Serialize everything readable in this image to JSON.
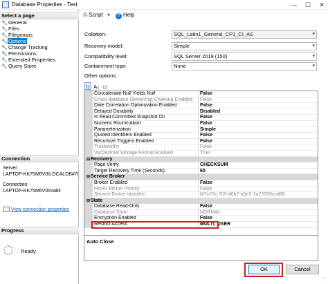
{
  "window": {
    "title": "Database Properties - Test",
    "minimize_glyph": "—",
    "maximize_glyph": "☐",
    "close_glyph": "✕"
  },
  "left": {
    "select_page_header": "Select a page",
    "pages": [
      {
        "label": "General",
        "icon": "wrench-icon",
        "selected": false
      },
      {
        "label": "Files",
        "icon": "wrench-icon",
        "selected": false
      },
      {
        "label": "Filegroups",
        "icon": "wrench-icon",
        "selected": false
      },
      {
        "label": "Options",
        "icon": "wrench-icon",
        "selected": true
      },
      {
        "label": "Change Tracking",
        "icon": "wrench-icon",
        "selected": false
      },
      {
        "label": "Permissions",
        "icon": "wrench-icon",
        "selected": false
      },
      {
        "label": "Extended Properties",
        "icon": "wrench-icon",
        "selected": false
      },
      {
        "label": "Query Store",
        "icon": "wrench-icon",
        "selected": false
      }
    ],
    "connection_header": "Connection",
    "server_label": "Server:",
    "server_value": "LAPTOP-KK75M6V0\\LOCALDB#7(",
    "connection_label": "Connection:",
    "connection_value": "LAPTOP-KK75M6V0\\mail4",
    "view_connection_link": "View connection properties",
    "progress_header": "Progress",
    "progress_status": "Ready"
  },
  "toolbar": {
    "script_label": "Script",
    "help_label": "Help"
  },
  "form": {
    "collation_label": "Collation:",
    "collation_value": "SQL_Latin1_General_CP1_CI_AS",
    "recovery_label": "Recovery model:",
    "recovery_value": "Simple",
    "compat_label": "Compatibility level:",
    "compat_value": "SQL Server 2019 (150)",
    "containment_label": "Containment type:",
    "containment_value": "None",
    "other_options_label": "Other options:"
  },
  "grid": {
    "rows": [
      {
        "type": "prop",
        "name": "Concatenate Null Yields Null",
        "value": "False",
        "readonly": false
      },
      {
        "type": "prop",
        "name": "Cross-database Ownership Chaining Enabled",
        "value": "False",
        "readonly": true
      },
      {
        "type": "prop",
        "name": "Date Correlation Optimization Enabled",
        "value": "False",
        "readonly": false
      },
      {
        "type": "prop",
        "name": "Delayed Durability",
        "value": "Disabled",
        "readonly": false
      },
      {
        "type": "prop",
        "name": "Is Read Committed Snapshot On",
        "value": "False",
        "readonly": false
      },
      {
        "type": "prop",
        "name": "Numeric Round-Abort",
        "value": "False",
        "readonly": false
      },
      {
        "type": "prop",
        "name": "Parameterization",
        "value": "Simple",
        "readonly": false
      },
      {
        "type": "prop",
        "name": "Quoted Identifiers Enabled",
        "value": "False",
        "readonly": false
      },
      {
        "type": "prop",
        "name": "Recursive Triggers Enabled",
        "value": "False",
        "readonly": false
      },
      {
        "type": "prop",
        "name": "Trustworthy",
        "value": "False",
        "readonly": true
      },
      {
        "type": "prop",
        "name": "VarDecimal Storage Format Enabled",
        "value": "True",
        "readonly": true
      },
      {
        "type": "cat",
        "name": "Recovery"
      },
      {
        "type": "prop",
        "name": "Page Verify",
        "value": "CHECKSUM",
        "readonly": false
      },
      {
        "type": "prop",
        "name": "Target Recovery Time (Seconds)",
        "value": "60",
        "readonly": false
      },
      {
        "type": "cat",
        "name": "Service Broker"
      },
      {
        "type": "prop",
        "name": "Broker Enabled",
        "value": "False",
        "readonly": false
      },
      {
        "type": "prop",
        "name": "Honor Broker Priority",
        "value": "False",
        "readonly": true
      },
      {
        "type": "prop",
        "name": "Service Broker Identifier",
        "value": "bf7cf7fc-7f2f-46b7-a3e3-1a72059ccd68",
        "readonly": true
      },
      {
        "type": "cat",
        "name": "State"
      },
      {
        "type": "prop",
        "name": "Database Read-Only",
        "value": "False",
        "readonly": false
      },
      {
        "type": "prop",
        "name": "Database State",
        "value": "NORMAL",
        "readonly": true
      },
      {
        "type": "prop",
        "name": "Encryption Enabled",
        "value": "False",
        "readonly": false
      },
      {
        "type": "prop",
        "name": "Restrict Access",
        "value": "MULTI_USER",
        "readonly": false
      }
    ]
  },
  "description": {
    "title": "Auto Close"
  },
  "buttons": {
    "ok_label": "OK",
    "cancel_label": "Cancel"
  },
  "colors": {
    "selection_blue": "#0078d7",
    "highlight_red": "#cc1f1f",
    "link_blue": "#0b5aa8"
  }
}
